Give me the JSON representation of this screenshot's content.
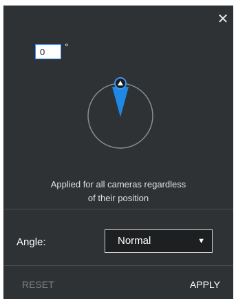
{
  "header": {
    "close_icon": "close-icon",
    "close_glyph": "✕"
  },
  "rotation": {
    "angle_value": "0",
    "degree_symbol": "°"
  },
  "info": {
    "line1": "Applied for all cameras regardless",
    "line2": "of their position"
  },
  "angle_control": {
    "label": "Angle:",
    "selected": "Normal"
  },
  "footer": {
    "reset_label": "RESET",
    "apply_label": "APPLY"
  },
  "colors": {
    "panel_bg": "#2f3235",
    "accent": "#1e88e5",
    "input_border": "#2d8cff"
  }
}
